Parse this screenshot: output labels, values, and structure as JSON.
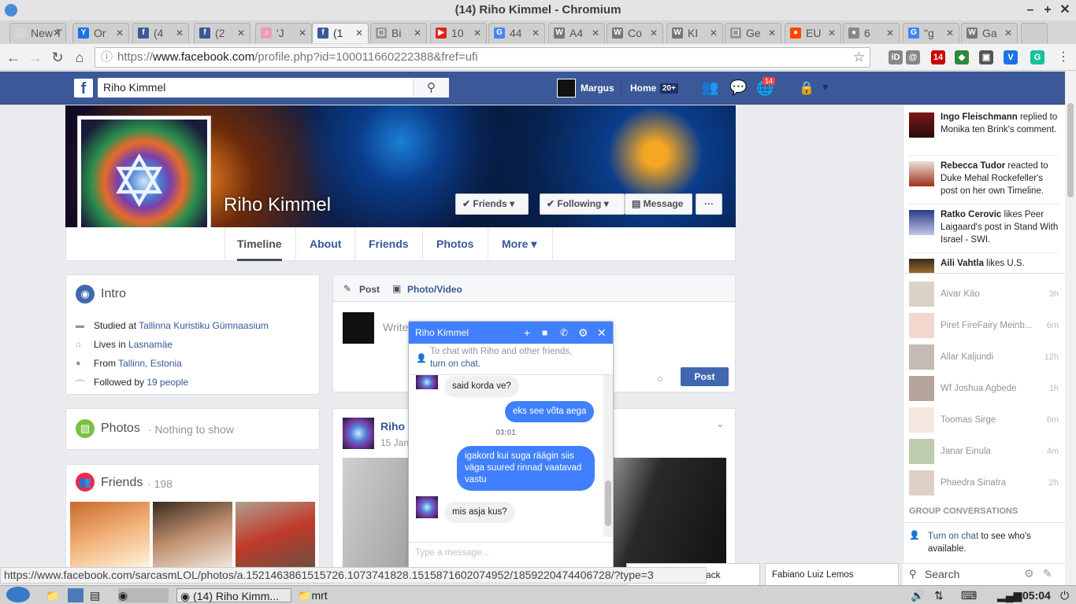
{
  "window": {
    "title": "(14) Riho Kimmel - Chromium"
  },
  "tabs": [
    {
      "label": "New T",
      "fav": "",
      "color": "#d6d6d6"
    },
    {
      "label": "Or",
      "fav": "Y",
      "color": "#1a73e8"
    },
    {
      "label": "(4",
      "fav": "f",
      "color": "#3b5998"
    },
    {
      "label": "(2",
      "fav": "f",
      "color": "#3b5998"
    },
    {
      "label": "'J",
      "fav": "♪",
      "color": "#e8a0b0"
    },
    {
      "label": "(1",
      "fav": "f",
      "color": "#3b5998"
    },
    {
      "label": "Bi",
      "fav": "▢",
      "color": "#999"
    },
    {
      "label": "10",
      "fav": "▶",
      "color": "#e62117"
    },
    {
      "label": "44",
      "fav": "G",
      "color": "#4285f4"
    },
    {
      "label": "A4",
      "fav": "W",
      "color": "#777"
    },
    {
      "label": "Co",
      "fav": "W",
      "color": "#777"
    },
    {
      "label": "KI",
      "fav": "W",
      "color": "#777"
    },
    {
      "label": "Ge",
      "fav": "▢",
      "color": "#999"
    },
    {
      "label": "EU",
      "fav": "●",
      "color": "#ff4500"
    },
    {
      "label": "6",
      "fav": "●",
      "color": "#888"
    },
    {
      "label": "\"g",
      "fav": "G",
      "color": "#4285f4"
    },
    {
      "label": "Ga",
      "fav": "W",
      "color": "#777"
    }
  ],
  "omnibox": {
    "scheme": "https://",
    "host": "www.facebook.com",
    "path": "/profile.php?id=100011660222388&fref=ufi"
  },
  "extensions": [
    {
      "label": "iD",
      "color": "#888"
    },
    {
      "label": "@",
      "color": "#888"
    },
    {
      "label": "14",
      "color": "#c00"
    },
    {
      "label": "◆",
      "color": "#2a8a3a"
    },
    {
      "label": "▣",
      "color": "#555"
    },
    {
      "label": "V",
      "color": "#1a73e8"
    },
    {
      "label": "G",
      "color": "#15c39a"
    }
  ],
  "fb": {
    "search_value": "Riho Kimmel",
    "user": "Margus",
    "home": "Home",
    "home_badge": "20+",
    "notif_badge": "14"
  },
  "profile": {
    "name": "Riho Kimmel",
    "friends_btn": "Friends",
    "following_btn": "Following",
    "message_btn": "Message",
    "more_btn": "···",
    "nav": [
      "Timeline",
      "About",
      "Friends",
      "Photos",
      "More"
    ]
  },
  "intro": {
    "title": "Intro",
    "rows": [
      {
        "prefix": "Studied at ",
        "link": "Tallinna Kuristiku Gümnaasium",
        "suffix": ""
      },
      {
        "prefix": "Lives in ",
        "link": "Lasnamäe",
        "suffix": ""
      },
      {
        "prefix": "From ",
        "link": "Tallinn, Estonia",
        "suffix": ""
      },
      {
        "prefix": "Followed by ",
        "link": "19 people",
        "suffix": ""
      }
    ]
  },
  "photos": {
    "title": "Photos",
    "sub": "· Nothing to show"
  },
  "friends": {
    "title": "Friends",
    "count": "· 198"
  },
  "composer": {
    "post": "Post",
    "photo": "Photo/Video",
    "placeholder": "Write",
    "post_btn": "Post"
  },
  "post": {
    "author": "Riho",
    "date": "15 Jan"
  },
  "chat": {
    "title": "Riho Kimmel",
    "notice": "To chat with Riho and other friends,",
    "notice_link": "turn on chat.",
    "messages": [
      {
        "from": "them",
        "text": "said korda ve?"
      },
      {
        "from": "me",
        "text": "eks see võta aega"
      },
      {
        "from": "time",
        "text": "03:01"
      },
      {
        "from": "me",
        "text": "igakord kui suga räägin siis väga suured rinnad vaatavad vastu"
      },
      {
        "from": "them",
        "text": "mis asja kus?"
      }
    ],
    "input_placeholder": "Type a message..."
  },
  "ticker": [
    {
      "name": "Ingo Fleischmann",
      "text": " replied to Monika ten Brink's comment."
    },
    {
      "name": "Rebecca Tudor",
      "text": " reacted to Duke Mehal Rockefeller's post on her own Timeline."
    },
    {
      "name": "Ratko Cerovic",
      "text": " likes Peer Laigaard's post in Stand With Israel - SWI."
    },
    {
      "name": "Aili Vahtla",
      "text": " likes U.S."
    }
  ],
  "chat_friends": [
    {
      "name": "Aivar Käo",
      "time": "3h"
    },
    {
      "name": "Piret FireFairy Meinb...",
      "time": "6m"
    },
    {
      "name": "Allar Kaljundi",
      "time": "12h"
    },
    {
      "name": "Wf Joshua Agbede",
      "time": "1h"
    },
    {
      "name": "Toomas Sirge",
      "time": "6m"
    },
    {
      "name": "Janar Einula",
      "time": "4m"
    },
    {
      "name": "Phaedra Sinatra",
      "time": "2h"
    }
  ],
  "sidebar": {
    "group_header": "GROUP CONVERSATIONS",
    "turn_on_link": "Turn on chat",
    "turn_on_rest": " to see who's available.",
    "search": "Search"
  },
  "bottom_chat": {
    "tab1": "ack",
    "tab2": "Fabiano Luiz Lemos"
  },
  "statusbar": "https://www.facebook.com/sarcasmLOL/photos/a.1521463861515726.1073741828.1515871602074952/1859220474406728/?type=3",
  "taskbar": {
    "chromium": "(14) Riho Kimm...",
    "folder": "mrt",
    "clock": "05:04"
  }
}
